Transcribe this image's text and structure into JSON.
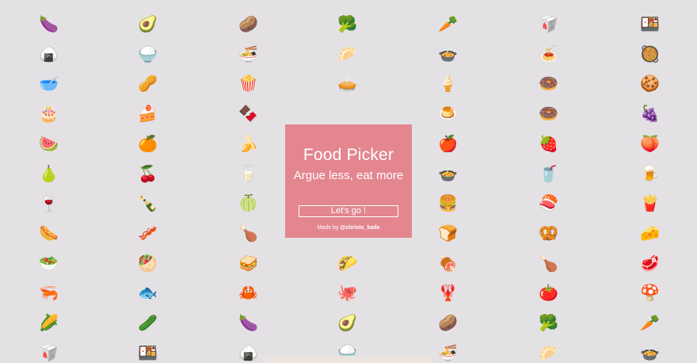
{
  "card": {
    "title": "Food Picker",
    "tagline": "Argue less, eat more",
    "button_label": "Let's go !",
    "credit_prefix": "Made by",
    "credit_handle": "@christo_kade",
    "background_color": "#e3868f"
  },
  "emoji_grid": {
    "background_color": "#e3e1e4",
    "columns": 7,
    "rows": [
      [
        "🍆",
        "🥑",
        "🥔",
        "🥦",
        "🥕",
        "🥡",
        "🍱"
      ],
      [
        "🍙",
        "🍚",
        "🍜",
        "🥟",
        "🍲",
        "🍝",
        "🥘"
      ],
      [
        "🥣",
        "🥜",
        "🍿",
        "🥧",
        "🍦",
        "🍩",
        "🍪"
      ],
      [
        "🎂",
        "🍰",
        "🍫",
        "🍬",
        "🍮",
        "🍩",
        "🍇"
      ],
      [
        "🍉",
        "🍊",
        "🍌",
        "🍏",
        "🍎",
        "🍓",
        "🍑"
      ],
      [
        "🍐",
        "🍒",
        "🥛",
        "🍵",
        "🍲",
        "🥤",
        "🍺"
      ],
      [
        "🍷",
        "🍾",
        "🍈",
        "🍔",
        "🍔",
        "🍣",
        "🍟"
      ],
      [
        "🌭",
        "🥓",
        "🍗",
        "🍗",
        "🍞",
        "🥨",
        "🧀"
      ],
      [
        "🥗",
        "🥙",
        "🥪",
        "🌮",
        "🍖",
        "🍗",
        "🥩"
      ],
      [
        "🦐",
        "🐟",
        "🦀",
        "🐙",
        "🦞",
        "🍅",
        "🍄"
      ],
      [
        "🌽",
        "🥒",
        "🍆",
        "🥑",
        "🥔",
        "🥦",
        "🥕"
      ],
      [
        "🥡",
        "🍱",
        "🍙",
        "🍚",
        "🍜",
        "🥟",
        "🍲"
      ]
    ]
  }
}
